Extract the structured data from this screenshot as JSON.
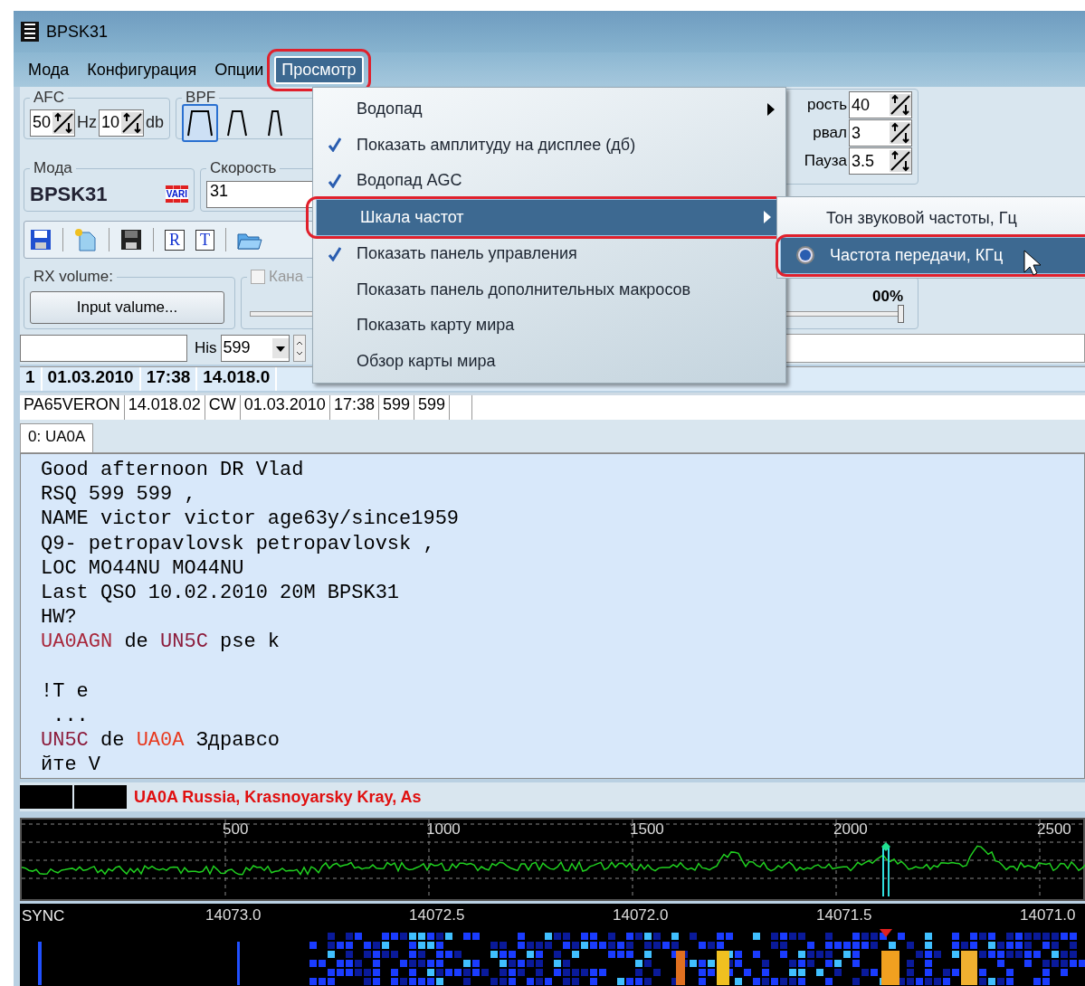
{
  "window": {
    "title": "BPSK31"
  },
  "menubar": [
    {
      "label": "Мода",
      "selected": false,
      "highlighted": false
    },
    {
      "label": "Конфигурация",
      "selected": false,
      "highlighted": false
    },
    {
      "label": "Опции",
      "selected": false,
      "highlighted": false
    },
    {
      "label": "Просмотр",
      "selected": true,
      "highlighted": true
    }
  ],
  "afc": {
    "title": "AFC",
    "spins": [
      {
        "value": "50",
        "unit": "Hz"
      },
      {
        "value": "10",
        "unit": "db"
      }
    ]
  },
  "bpf": {
    "title": "BPF",
    "filters": [
      {
        "kind": "wide",
        "selected": true
      },
      {
        "kind": "medium",
        "selected": false
      },
      {
        "kind": "narrow",
        "selected": false
      }
    ]
  },
  "cw": {
    "spins": [
      {
        "label": "рость",
        "value": "40"
      },
      {
        "label": "рвал",
        "value": "3"
      },
      {
        "label": "Пауза",
        "value": "3.5"
      }
    ]
  },
  "mode": {
    "title": "Мода",
    "value": "BPSK31",
    "badge": "VARI"
  },
  "speed": {
    "title": "Скорость",
    "value": "31"
  },
  "toolbar": [
    {
      "kind": "save"
    },
    {
      "kind": "new"
    },
    {
      "kind": "save-dark"
    },
    {
      "kind": "doc",
      "letter": "R"
    },
    {
      "kind": "doc",
      "letter": "T"
    },
    {
      "kind": "open"
    }
  ],
  "rx_volume": {
    "title": "RX volume:",
    "button": "Input valume..."
  },
  "channel": {
    "title": "Кана",
    "checked": false,
    "disabled": true,
    "percent": "00%",
    "level": 1
  },
  "report": {
    "label": "His",
    "value": "599"
  },
  "log_header": [
    "1",
    "01.03.2010",
    "17:38",
    "14.018.0"
  ],
  "log_row": [
    "PA65VERON",
    "14.018.02",
    "CW",
    "01.03.2010",
    "17:38",
    "599",
    "599"
  ],
  "tabs": [
    {
      "label": "0: UA0A",
      "selected": true
    }
  ],
  "text_lines": [
    [
      {
        "text": "Good afternoon DR Vlad"
      }
    ],
    [
      {
        "text": "RSQ 599 599 ,"
      }
    ],
    [
      {
        "text": "NAME victor victor age63y/since1959"
      }
    ],
    [
      {
        "text": "Q9- petropavlovsk petropavlovsk ,"
      }
    ],
    [
      {
        "text": "LOC MO44NU MO44NU"
      }
    ],
    [
      {
        "text": "Last QSO 10.02.2010 20M BPSK31"
      }
    ],
    [
      {
        "text": "HW?"
      }
    ],
    [
      {
        "text": "UA0AGN",
        "color": "#a8283c"
      },
      {
        "text": " de "
      },
      {
        "text": "UN5C",
        "color": "#8c1c3c"
      },
      {
        "text": " pse k"
      }
    ],
    {
      "gap_before": true,
      "segments": [
        {
          "text": "!T e"
        }
      ]
    },
    [
      {
        "text": " ..."
      }
    ],
    [
      {
        "text": "UN5C",
        "color": "#8c1c3c"
      },
      {
        "text": " de "
      },
      {
        "text": "UA0A",
        "color": "#e8391e"
      },
      {
        "text": " Здравсо"
      }
    ],
    [
      {
        "text": "йте V"
      }
    ]
  ],
  "station_info": "UA0A Russia, Krasnoyarsky Kray, As",
  "spectrum": {
    "scale": [
      "500",
      "1000",
      "1500",
      "2000",
      "2500"
    ]
  },
  "waterfall": {
    "label": "SYNC",
    "scale": [
      "14073.0",
      "14072.5",
      "14072.0",
      "14071.5",
      "14071.0"
    ]
  },
  "view_menu": [
    {
      "label": "Водопад",
      "checked": false,
      "submenu": true,
      "selected": false,
      "highlighted": false
    },
    {
      "label": "Показать амплитуду на дисплее (дб)",
      "checked": true,
      "submenu": false,
      "selected": false,
      "highlighted": false
    },
    {
      "label": "Водопад AGC",
      "checked": true,
      "submenu": false,
      "selected": false,
      "highlighted": false
    },
    {
      "label": "Шкала частот",
      "checked": false,
      "submenu": true,
      "selected": true,
      "highlighted": true
    },
    {
      "label": "Показать панель управления",
      "checked": true,
      "submenu": false,
      "selected": false,
      "highlighted": false
    },
    {
      "label": "Показать панель дополнительных макросов",
      "checked": false,
      "submenu": false,
      "selected": false,
      "highlighted": false
    },
    {
      "label": "Показать карту мира",
      "checked": false,
      "submenu": false,
      "selected": false,
      "highlighted": false
    },
    {
      "label": "Обзор карты мира",
      "checked": false,
      "submenu": false,
      "selected": false,
      "highlighted": false
    }
  ],
  "scale_submenu": [
    {
      "label": "Тон звуковой частоты, Гц",
      "checked": false,
      "selected": false,
      "highlighted": false
    },
    {
      "label": "Частота передачи, КГц",
      "checked": true,
      "selected": true,
      "highlighted": true
    }
  ]
}
